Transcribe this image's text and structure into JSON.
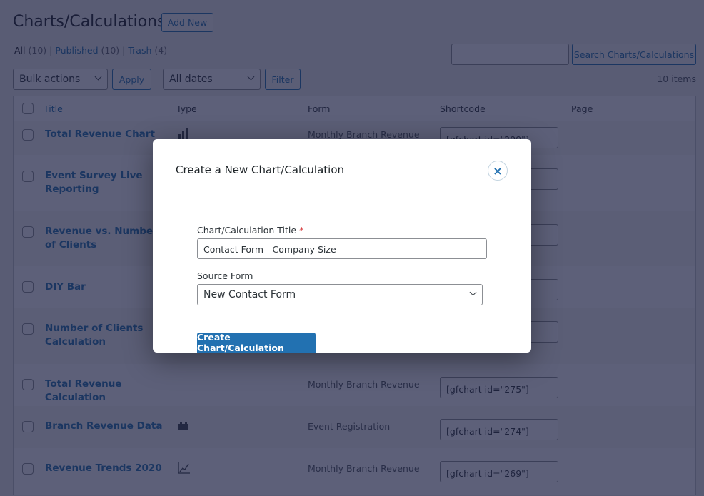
{
  "page": {
    "title": "Charts/Calculations",
    "add_new": "Add New",
    "filters": [
      {
        "label": "All",
        "count": "(10)"
      },
      {
        "label": "Published",
        "count": "(10)"
      },
      {
        "label": "Trash",
        "count": "(4)"
      }
    ],
    "search_button": "Search Charts/Calculations",
    "search_value": "",
    "bulk_actions": "Bulk actions",
    "apply": "Apply",
    "dates": "All dates",
    "filter": "Filter",
    "items_count": "10 items"
  },
  "table": {
    "columns": [
      "Title",
      "Type",
      "Form",
      "Shortcode",
      "Page"
    ],
    "rows": [
      {
        "title": "Total Revenue Chart",
        "type_icon": "bar-chart-icon",
        "form": "Monthly Branch Revenue",
        "shortcode": "[gfchart id=\"299\"]"
      },
      {
        "title": "Event Survey Live Reporting",
        "shortcode": ""
      },
      {
        "title": "Revenue vs. Number of Clients",
        "shortcode": ""
      },
      {
        "title": "DIY Bar",
        "shortcode": ""
      },
      {
        "title": "Number of Clients Calculation",
        "shortcode": ""
      },
      {
        "title": "Total Revenue Calculation",
        "form": "Monthly Branch Revenue",
        "shortcode": "[gfchart id=\"275\"]"
      },
      {
        "title": "Branch Revenue Data",
        "type_icon": "table-icon",
        "form": "Event Registration",
        "shortcode": "[gfchart id=\"274\"]"
      },
      {
        "title": "Revenue Trends 2020",
        "type_icon": "line-chart-icon",
        "form": "Monthly Branch Revenue",
        "shortcode": "[gfchart id=\"269\"]"
      }
    ]
  },
  "modal": {
    "title": "Create a New Chart/Calculation",
    "title_label": "Chart/Calculation Title",
    "required_mark": "*",
    "title_value": "Contact Form - Company Size",
    "source_label": "Source Form",
    "source_value": "New Contact Form",
    "create_button": "Create Chart/Calculation",
    "close": "×"
  },
  "colors": {
    "accent": "#2271b1",
    "required": "#d63638"
  }
}
